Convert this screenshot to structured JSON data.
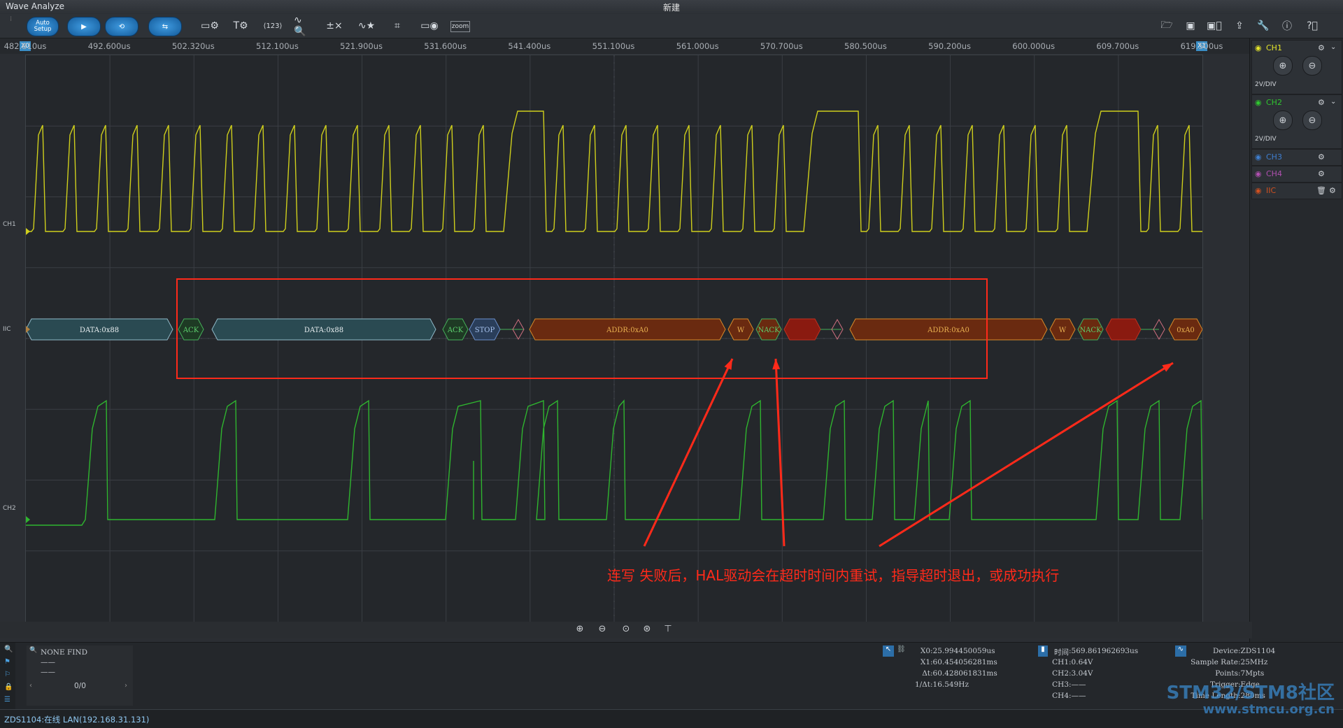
{
  "window": {
    "app_title": "Wave Analyze",
    "doc_title": "新建"
  },
  "toolbar": {
    "auto_setup_label": "Auto\nSetup",
    "zoom_label": "zoom",
    "icons": [
      "run-icon",
      "loop-icon",
      "swap-icon",
      "display-icon",
      "settings-icon",
      "decode-123-icon",
      "measure-icon",
      "math-icon",
      "fft-star-icon",
      "crop-icon",
      "eye-window-icon",
      "zoom-icon",
      "folder-open-icon",
      "save-icon",
      "save-as-icon",
      "export-icon",
      "tools-icon",
      "info-icon",
      "help-icon"
    ]
  },
  "time_axis": {
    "markers": {
      "left": "X0",
      "right": "X1"
    },
    "ticks": [
      "482.810us",
      "492.600us",
      "502.320us",
      "512.100us",
      "521.900us",
      "531.600us",
      "541.400us",
      "551.100us",
      "561.000us",
      "570.700us",
      "580.500us",
      "590.200us",
      "600.000us",
      "609.700us",
      "619.500us"
    ]
  },
  "channels": {
    "ch1": {
      "label": "CH1",
      "color": "#d6d61e"
    },
    "ch2": {
      "label": "CH2",
      "color": "#2fb52f"
    },
    "iic": {
      "label": "IIC"
    }
  },
  "decode_packets": [
    {
      "text": "DATA:0x88",
      "kind": "data"
    },
    {
      "text": "ACK",
      "kind": "ack"
    },
    {
      "text": "DATA:0x88",
      "kind": "data"
    },
    {
      "text": "ACK",
      "kind": "ack"
    },
    {
      "text": "STOP",
      "kind": "stop"
    },
    {
      "text": "ADDR:0xA0",
      "kind": "addr"
    },
    {
      "text": "W",
      "kind": "w"
    },
    {
      "text": "NACK",
      "kind": "nack"
    },
    {
      "text": "ADDR:0xA0",
      "kind": "addr"
    },
    {
      "text": "W",
      "kind": "w"
    },
    {
      "text": "NACK",
      "kind": "nack"
    },
    {
      "text": "0xA0",
      "kind": "addr"
    }
  ],
  "annotation": "连写 失败后，HAL驱动会在超时时间内重试，指导超时退出，或成功执行",
  "right_panel": {
    "channels": [
      {
        "name": "CH1",
        "scale": "2V/DIV",
        "color": "#e5e52a"
      },
      {
        "name": "CH2",
        "scale": "2V/DIV",
        "color": "#2fc52f"
      },
      {
        "name": "CH3",
        "color": "#3f7fd0"
      },
      {
        "name": "CH4",
        "color": "#b050b0"
      },
      {
        "name": "IIC",
        "color": "#d05020"
      }
    ]
  },
  "search_panel": {
    "title": "NONE FIND",
    "dash1": "——",
    "dash2": "——",
    "page": "0/0"
  },
  "cursor_panel": {
    "rows": [
      {
        "k": "X0",
        "v": "25.994450059us"
      },
      {
        "k": "X1",
        "v": "60.454056281ms"
      },
      {
        "k": "Δt",
        "v": "60.428061831ms"
      },
      {
        "k": "1/Δt",
        "v": "16.549Hz"
      }
    ]
  },
  "level_panel": {
    "rows": [
      {
        "k": "时间",
        "v": "569.861962693us"
      },
      {
        "k": "CH1",
        "v": "0.64V"
      },
      {
        "k": "CH2",
        "v": "3.04V"
      },
      {
        "k": "CH3",
        "v": "——"
      },
      {
        "k": "CH4",
        "v": "——"
      }
    ]
  },
  "device_panel": {
    "rows": [
      {
        "k": "Device",
        "v": "ZDS1104"
      },
      {
        "k": "Sample Rate",
        "v": "25MHz"
      },
      {
        "k": "Points",
        "v": "7Mpts"
      },
      {
        "k": "Trigger",
        "v": "Edge"
      },
      {
        "k": "Time Length",
        "v": "280ms"
      }
    ]
  },
  "status": "ZDS1104:在线 LAN(192.168.31.131)",
  "watermark": {
    "line1": "STM32/STM8社区",
    "line2": "www.stmcu.org.cn"
  }
}
